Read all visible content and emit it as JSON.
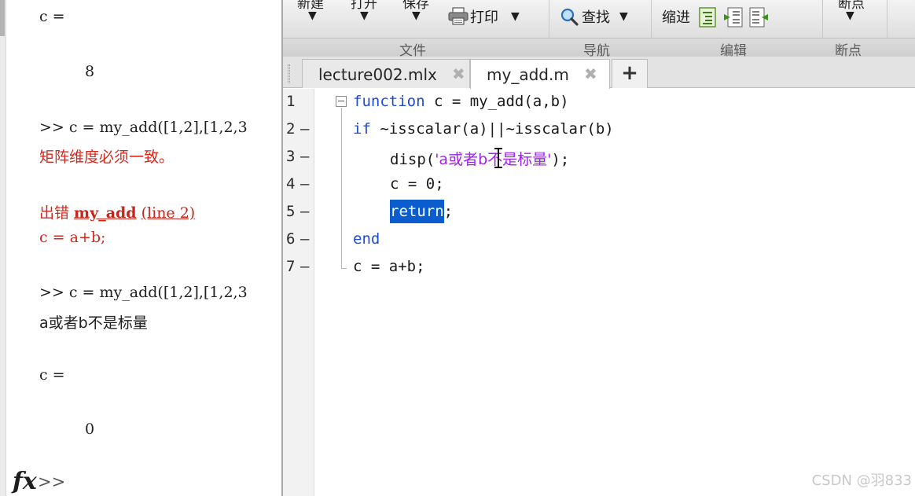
{
  "command_window": {
    "lines": {
      "c_label_1": "c =",
      "value_1": "8",
      "cmd_1": ">> c = my_add([1,2],[1,2,3",
      "error_msg": "矩阵维度必须一致。",
      "error_prefix": "出错 ",
      "error_func": "my_add",
      "error_loc": "(line 2)",
      "error_code": "c = a+b;",
      "cmd_2": ">> c = my_add([1,2],[1,2,3",
      "output_msg": "a或者b不是标量",
      "c_label_2": "c =",
      "value_2": "0"
    },
    "fx_icon": "fx",
    "prompt": ">>"
  },
  "toolstrip": {
    "partial_labels": [
      "新建",
      "打开",
      "保存",
      "断点"
    ],
    "print_label": "打印",
    "find_label": "查找",
    "indent_label": "缩进",
    "sections": [
      "文件",
      "导航",
      "编辑",
      "断点"
    ]
  },
  "tabs": [
    {
      "label": "lecture002.mlx",
      "active": false
    },
    {
      "label": "my_add.m",
      "active": true
    }
  ],
  "tab_add_label": "+",
  "editor": {
    "line_numbers": [
      "1",
      "2",
      "3",
      "4",
      "5",
      "6",
      "7"
    ],
    "code": {
      "l1_kw": "function",
      "l1_rest": " c = my_add(a,b)",
      "l2_kw": "if",
      "l2_rest": " ~isscalar(a)||~isscalar(b)",
      "l3_pre": "disp(",
      "l3_str": "'a或者b不是标量'",
      "l3_post": ");",
      "l4": "c = 0;",
      "l5_sel": "return",
      "l5_post": ";",
      "l6_kw": "end",
      "l7": "c = a+b;"
    }
  },
  "watermark": "CSDN @羽833",
  "colors": {
    "keyword": "#1e4bd2",
    "string": "#a020f0",
    "error": "#d5281d",
    "selection": "#0a5ccf"
  }
}
